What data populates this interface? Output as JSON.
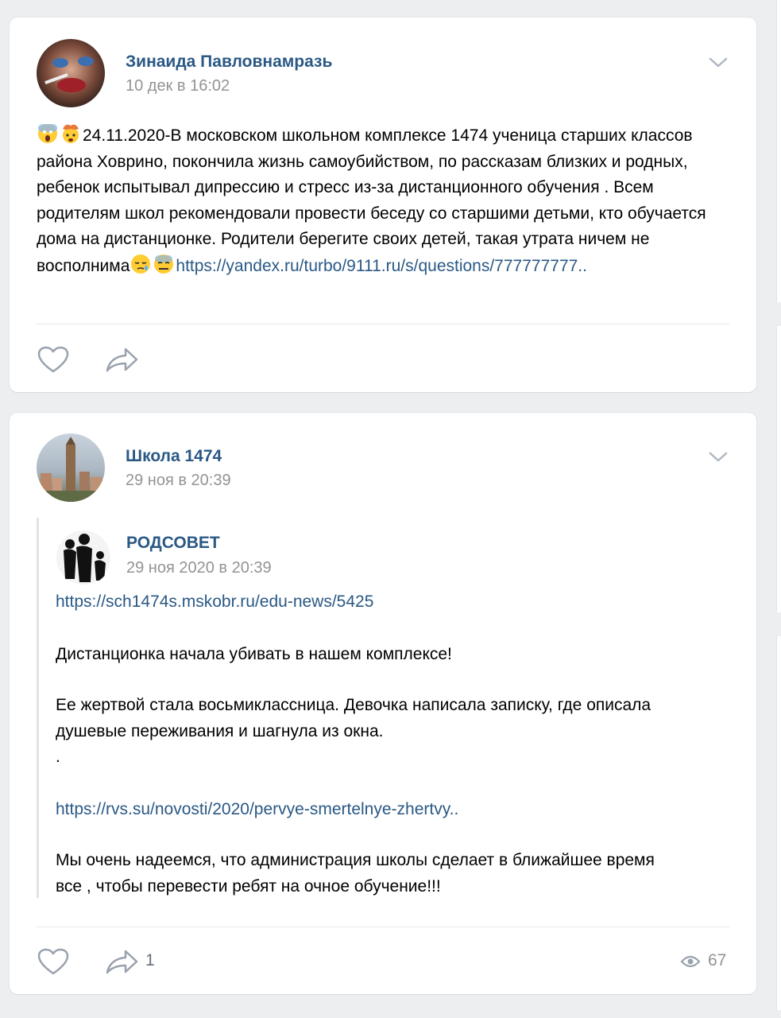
{
  "posts": [
    {
      "author": "Зинаида Павловнамразь",
      "date": "10 дек в 16:02",
      "text_main": "24.11.2020-В московском школьном комплексе 1474 ученица старших классов района Ховрино, покончила жизнь самоубийством, по рассказам близких и родных, ребенок испытывал дипрессию и стресс из-за дистанционного обучения . Всем родителям школ рекомендовали провести беседу со старшими детьми, кто обучается дома на дистанционке. Родители берегите своих детей, такая утрата ничем не восполнима",
      "link": "https://yandex.ru/turbo/9111.ru/s/questions/777777777..",
      "emoji_leading": [
        "screaming-face-emoji",
        "exploding-head-emoji"
      ],
      "emoji_trailing": [
        "sleepy-face-emoji",
        "anxious-face-emoji"
      ]
    },
    {
      "author": "Школа 1474",
      "date": "29 ноя в 20:39",
      "repost": {
        "author": "РОДСОВЕТ",
        "date": "29 ноя 2020 в 20:39",
        "link1": "https://sch1474s.mskobr.ru/edu-news/5425",
        "para1": "Дистанционка начала убивать в нашем комплексе!",
        "para2_line1": "Ее жертвой стала восьмиклассница. Девочка написала записку, где описала",
        "para2_line2": "душевые переживания и шагнула из окна.",
        "dot": ".",
        "link2": "https://rvs.su/novosti/2020/pervye-smertelnye-zhertvy..",
        "para3_line1": "Мы очень надеемся, что администрация школы сделает в ближайшее время",
        "para3_line2": "все , чтобы перевести ребят на очное обучение!!!"
      },
      "share_count": "1",
      "views": "67"
    }
  ],
  "colors": {
    "link": "#2a5885",
    "muted": "#939393",
    "icon": "#99a2ad"
  }
}
